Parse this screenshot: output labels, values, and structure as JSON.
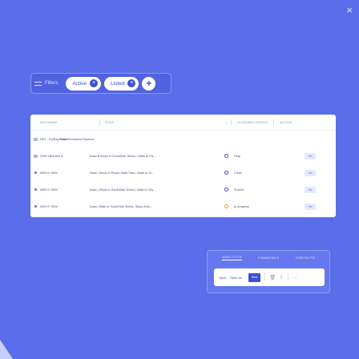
{
  "window": {
    "close_glyph": "×"
  },
  "filters": {
    "label": "Filters",
    "chips": [
      {
        "label": "Active"
      },
      {
        "label": "Listed"
      }
    ],
    "remove_glyph": "×",
    "add_glyph": "+"
  },
  "table": {
    "headers": {
      "nickname": "NICKNAME",
      "role": "ROLE",
      "sort_glyph": "↓",
      "cleaning_status": "CLEANING STATUS",
      "active": "ACTIVE"
    },
    "rows": [
      {
        "nickname": "DRT - DelRay Tower",
        "role": "Kasa Alexandria Potomac",
        "status": "",
        "active": ""
      },
      {
        "nickname": "SSW 1BD/1BA K",
        "role": "Kasa ♥ Steps to SouthSide Works • Walk to Pa...",
        "status": "Dirty",
        "active": "Yes"
      },
      {
        "nickname": "#503 K SSW",
        "role": "Kasa | Steps to Pointe State Park | Walk to Th...",
        "status": "Clean",
        "active": "Yes"
      },
      {
        "nickname": "#553 K SSW",
        "role": "Kasa | Steps to SouthSide Works | Walk to City...",
        "status": "Submit",
        "active": "Yes"
      },
      {
        "nickname": "#549 K SSW",
        "role": "Kasa | Walk to SouthSide Works. Steps from...",
        "status": "In progress",
        "active": "Yes"
      }
    ]
  },
  "bottom_panel": {
    "tabs": [
      "ANALYTICS",
      "FINANCIALS",
      "CONTACTS"
    ],
    "toolbar": {
      "save": "Save",
      "save_as": "Save as...",
      "primary": "Next",
      "icons": [
        "trash-icon",
        "share-icon",
        "more-icon"
      ],
      "trash_glyph": "🗑",
      "share_glyph": "⇪",
      "more_glyph": "⋯"
    }
  },
  "colors": {
    "background": "#5b6eea",
    "accent": "#3e4fd6",
    "status_orange": "#f29b2c"
  }
}
